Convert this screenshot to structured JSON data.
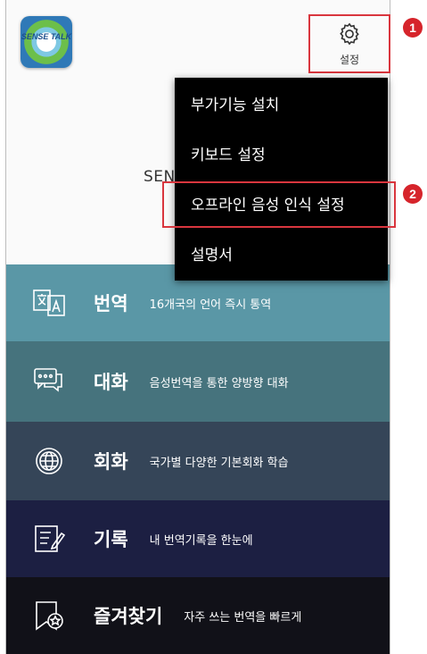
{
  "header": {
    "logo_text": "SENSE TALK",
    "settings_label": "설정",
    "brand_partial": "SEN"
  },
  "callouts": [
    "1",
    "2"
  ],
  "menu": {
    "items": [
      {
        "label": "부가기능 설치"
      },
      {
        "label": "키보드 설정"
      },
      {
        "label": "오프라인 음성 인식 설정"
      },
      {
        "label": "설명서"
      }
    ]
  },
  "features": [
    {
      "title": "번역",
      "desc": "16개국의 언어 즉시 통역",
      "icon": "translate-icon",
      "color": "#5a97a6"
    },
    {
      "title": "대화",
      "desc": "음성번역을 통한 양방향 대화",
      "icon": "chat-icon",
      "color": "#46737d"
    },
    {
      "title": "회화",
      "desc": "국가별 다양한 기본회화 학습",
      "icon": "globe-icon",
      "color": "#354558"
    },
    {
      "title": "기록",
      "desc": "내 번역기록을 한눈에",
      "icon": "edit-note-icon",
      "color": "#1c1f42"
    },
    {
      "title": "즐겨찾기",
      "desc": "자주 쓰는 번역을 빠르게",
      "icon": "bookmark-star-icon",
      "color": "#111118"
    }
  ]
}
